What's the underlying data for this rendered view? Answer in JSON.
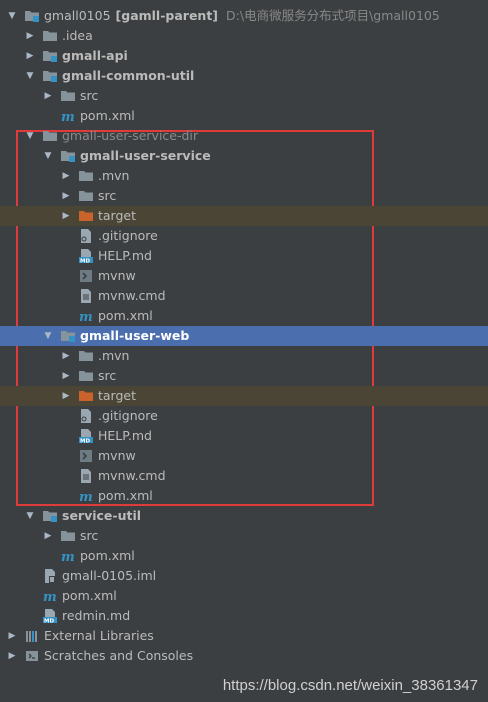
{
  "tree": [
    {
      "level": 0,
      "expanded": true,
      "icon": "module-folder-icon",
      "label": "gmall0105",
      "suffix": "[gamll-parent]",
      "path": "D:\\电商微服务分布式项目\\gmall0105"
    },
    {
      "level": 1,
      "expanded": false,
      "icon": "folder-icon",
      "label": ".idea"
    },
    {
      "level": 1,
      "expanded": false,
      "icon": "module-folder-icon",
      "label": "gmall-api",
      "bold": true
    },
    {
      "level": 1,
      "expanded": true,
      "icon": "module-folder-icon",
      "label": "gmall-common-util",
      "bold": true
    },
    {
      "level": 2,
      "expanded": false,
      "icon": "folder-icon",
      "label": "src"
    },
    {
      "level": 2,
      "icon": "maven-icon",
      "label": "pom.xml"
    },
    {
      "level": 1,
      "expanded": true,
      "icon": "folder-icon",
      "label": "gmall-user-service-dir",
      "dim": true
    },
    {
      "level": 2,
      "expanded": true,
      "icon": "module-folder-icon",
      "label": "gmall-user-service",
      "bold": true
    },
    {
      "level": 3,
      "expanded": false,
      "icon": "folder-icon",
      "label": ".mvn"
    },
    {
      "level": 3,
      "expanded": false,
      "icon": "folder-icon",
      "label": "src"
    },
    {
      "level": 3,
      "expanded": false,
      "icon": "target-folder-icon",
      "label": "target",
      "band": "target"
    },
    {
      "level": 3,
      "icon": "gitignore-icon",
      "label": ".gitignore"
    },
    {
      "level": 3,
      "icon": "markdown-icon",
      "label": "HELP.md"
    },
    {
      "level": 3,
      "icon": "shell-icon",
      "label": "mvnw"
    },
    {
      "level": 3,
      "icon": "text-file-icon",
      "label": "mvnw.cmd"
    },
    {
      "level": 3,
      "icon": "maven-icon",
      "label": "pom.xml"
    },
    {
      "level": 2,
      "expanded": true,
      "icon": "module-folder-icon",
      "label": "gmall-user-web",
      "bold": true,
      "band": "selected"
    },
    {
      "level": 3,
      "expanded": false,
      "icon": "folder-icon",
      "label": ".mvn"
    },
    {
      "level": 3,
      "expanded": false,
      "icon": "folder-icon",
      "label": "src"
    },
    {
      "level": 3,
      "expanded": false,
      "icon": "target-folder-icon",
      "label": "target",
      "band": "target"
    },
    {
      "level": 3,
      "icon": "gitignore-icon",
      "label": ".gitignore"
    },
    {
      "level": 3,
      "icon": "markdown-icon",
      "label": "HELP.md"
    },
    {
      "level": 3,
      "icon": "shell-icon",
      "label": "mvnw"
    },
    {
      "level": 3,
      "icon": "text-file-icon",
      "label": "mvnw.cmd"
    },
    {
      "level": 3,
      "icon": "maven-icon",
      "label": "pom.xml"
    },
    {
      "level": 1,
      "expanded": true,
      "icon": "module-folder-icon",
      "label": "service-util",
      "bold": true
    },
    {
      "level": 2,
      "expanded": false,
      "icon": "folder-icon",
      "label": "src"
    },
    {
      "level": 2,
      "icon": "maven-icon",
      "label": "pom.xml"
    },
    {
      "level": 1,
      "icon": "iml-file-icon",
      "label": "gmall-0105.iml"
    },
    {
      "level": 1,
      "icon": "maven-icon",
      "label": "pom.xml"
    },
    {
      "level": 1,
      "icon": "markdown-icon",
      "label": "redmin.md"
    },
    {
      "level": 0,
      "expanded": false,
      "icon": "libraries-icon",
      "label": "External Libraries"
    },
    {
      "level": 0,
      "expanded": false,
      "icon": "scratches-icon",
      "label": "Scratches and Consoles"
    }
  ],
  "watermark": "https://blog.csdn.net/weixin_38361347",
  "colors": {
    "background": "#3c3f41",
    "selected_row": "#4b6eaf",
    "target_row": "#4a4535",
    "highlight_border": "#e03a3a",
    "folder": "#87939a",
    "target_folder": "#c9632b",
    "maven": "#3592c4"
  }
}
